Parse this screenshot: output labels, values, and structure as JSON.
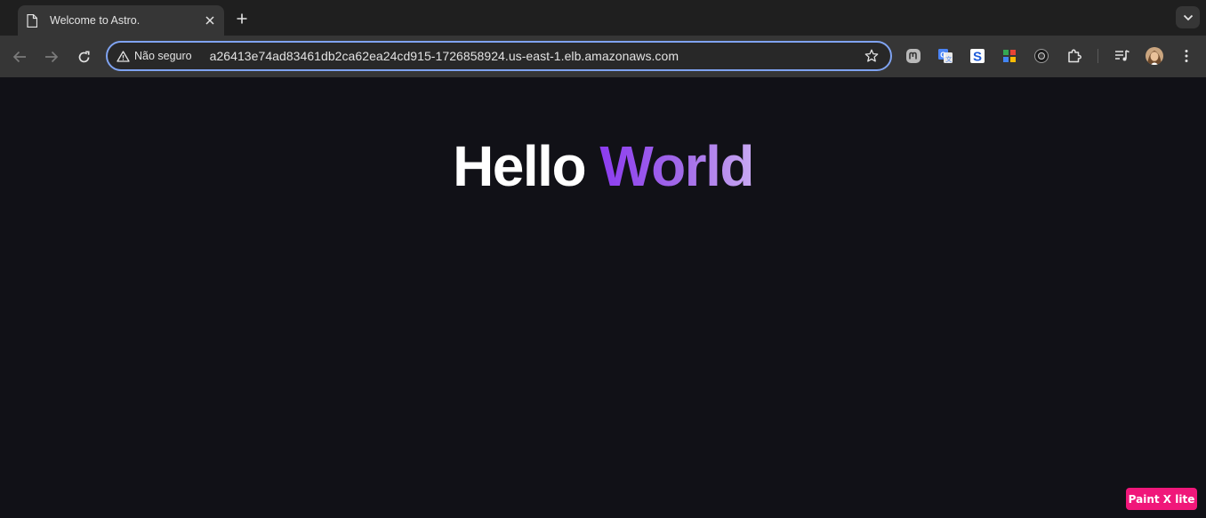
{
  "tab": {
    "title": "Welcome to Astro.",
    "icon": "page-icon"
  },
  "address_bar": {
    "security_label": "Não seguro",
    "url": "a26413e74ad83461db2ca62ea24cd915-1726858924.us-east-1.elb.amazonaws.com"
  },
  "extensions": [
    "mastodon-icon",
    "google-translate-icon",
    "s-extension-icon",
    "color-picker-icon",
    "dark-mode-icon",
    "puzzle-icon"
  ],
  "page": {
    "headline_part1": "Hello",
    "headline_part2": "World"
  },
  "badge": {
    "label": "Paint X lite"
  },
  "colors": {
    "accent_gradient_start": "#8c3cf0",
    "accent_gradient_end": "#c9a9f3",
    "omnibox_focus": "#7fa3f1",
    "badge": "#f0177a"
  }
}
